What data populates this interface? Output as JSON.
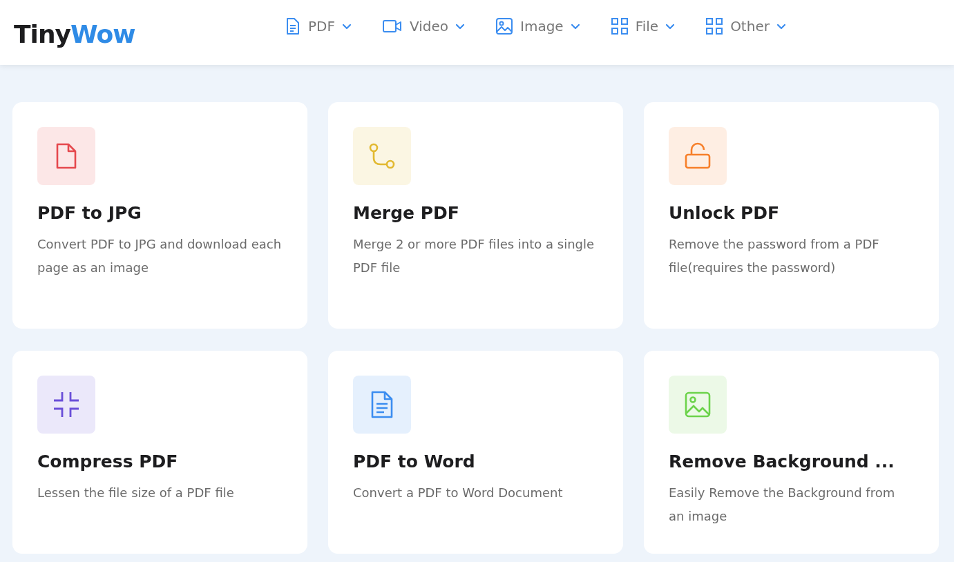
{
  "logo": {
    "dark": "Tiny",
    "accent": "Wow"
  },
  "nav": [
    {
      "label": "PDF",
      "kind": "document"
    },
    {
      "label": "Video",
      "kind": "video"
    },
    {
      "label": "Image",
      "kind": "image"
    },
    {
      "label": "File",
      "kind": "grid"
    },
    {
      "label": "Other",
      "kind": "grid"
    }
  ],
  "cards": [
    {
      "title": "PDF to JPG",
      "description": "Convert PDF to JPG and download each page as an image",
      "kind": "file",
      "color": "#e5484d"
    },
    {
      "title": "Merge PDF",
      "description": "Merge 2 or more PDF files into a single PDF file",
      "kind": "merge",
      "color": "#e2b930"
    },
    {
      "title": "Unlock PDF",
      "description": "Remove the password from a PDF file(requires the password)",
      "kind": "unlock",
      "color": "#f77f2a"
    },
    {
      "title": "Compress PDF",
      "description": "Lessen the file size of a PDF file",
      "kind": "compress",
      "color": "#6a4fd8"
    },
    {
      "title": "PDF to Word",
      "description": "Convert a PDF to Word Document",
      "kind": "document",
      "color": "#3b8df0"
    },
    {
      "title": "Remove Background ...",
      "description": "Easily Remove the Background from an image",
      "kind": "image",
      "color": "#6dd34c"
    }
  ]
}
